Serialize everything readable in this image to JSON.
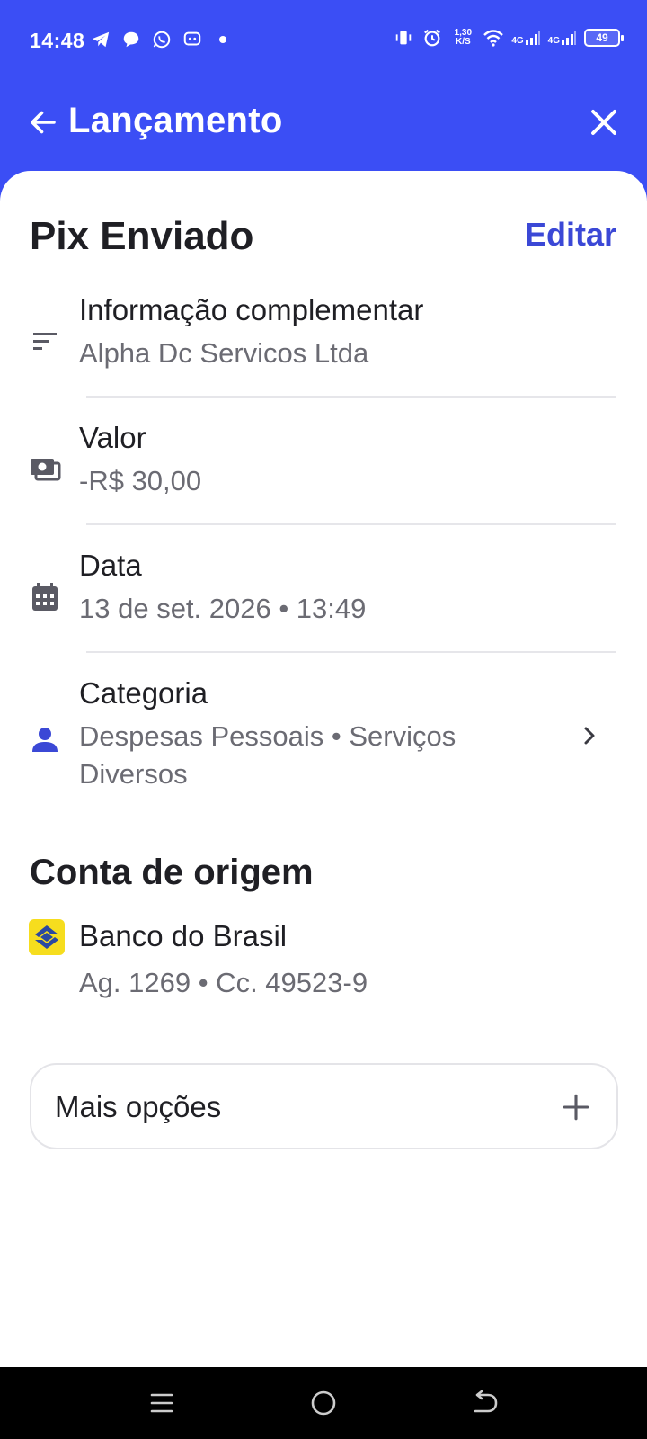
{
  "status_bar": {
    "time": "14:48",
    "net_speed_top": "1,30",
    "net_speed_bottom": "K/S",
    "net1": "4G",
    "net2": "4G",
    "battery": "49"
  },
  "app_bar": {
    "title": "Lançamento",
    "back_icon": "arrow-left-icon",
    "close_icon": "close-icon"
  },
  "transaction": {
    "type": "Pix Enviado",
    "edit_label": "Editar",
    "fields": [
      {
        "label": "Informação complementar",
        "value": "Alpha Dc Servicos Ltda",
        "icon": "notes-icon"
      },
      {
        "label": "Valor",
        "value": "-R$ 30,00",
        "icon": "money-icon"
      },
      {
        "label": "Data",
        "value": "13 de set. 2026 • 13:49",
        "icon": "calendar-icon"
      },
      {
        "label": "Categoria",
        "value": "Despesas Pessoais • Serviços Diversos",
        "icon": "person-icon"
      }
    ]
  },
  "account": {
    "section_title": "Conta de origem",
    "bank_name": "Banco do Brasil",
    "details": "Ag. 1269 • Cc. 49523-9"
  },
  "more_options": {
    "label": "Mais opções"
  },
  "colors": {
    "primary": "#3b4ef5",
    "accent": "#3b48d6",
    "bank_yellow": "#f6dd1e"
  }
}
